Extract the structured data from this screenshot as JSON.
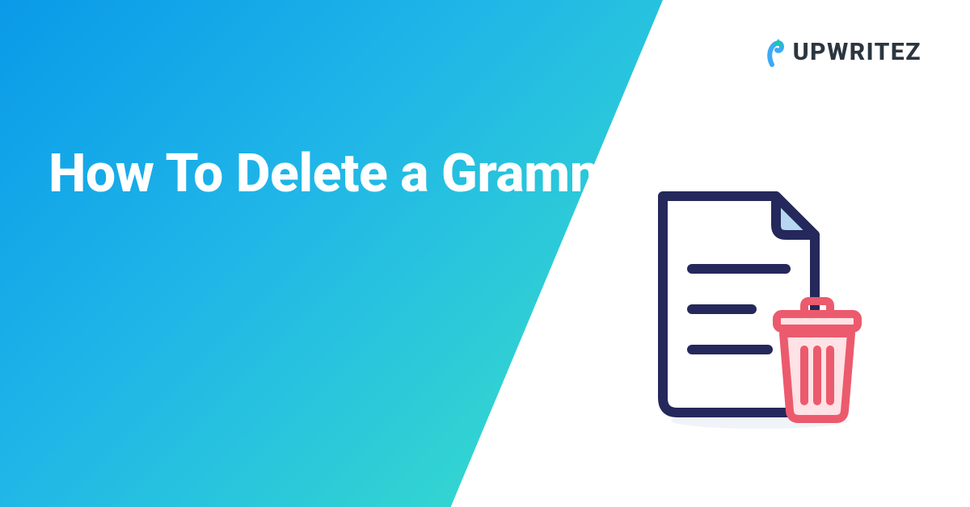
{
  "title": "How To Delete a Grammarly Account?",
  "brand": {
    "name": "UPWRITEZ"
  },
  "colors": {
    "gradient_start": "#0a9ae8",
    "gradient_mid": "#1fb5e8",
    "gradient_end": "#3be2c7",
    "brand_dark": "#2b3640",
    "brand_accent_blue": "#3da9f5",
    "brand_accent_teal": "#17c7b6",
    "doc_outline": "#25285a",
    "doc_fold": "#b6d7f0",
    "trash_color": "#ec5a6d",
    "trash_light": "#ffe2e5"
  }
}
